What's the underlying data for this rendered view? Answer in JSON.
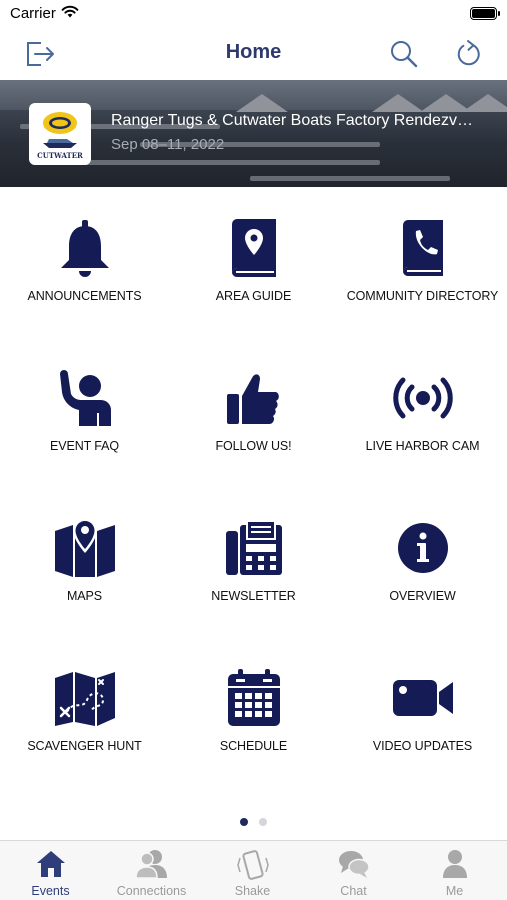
{
  "status_bar": {
    "carrier": "Carrier"
  },
  "nav": {
    "title": "Home"
  },
  "banner": {
    "title": "Ranger Tugs & Cutwater Boats Factory Rendezv…",
    "date": "Sep 08–11, 2022",
    "logo_text": "CUTWATER"
  },
  "tiles": [
    {
      "label": "ANNOUNCEMENTS",
      "icon": "bell-icon"
    },
    {
      "label": "AREA GUIDE",
      "icon": "map-book-icon"
    },
    {
      "label": "COMMUNITY DIRECTORY",
      "icon": "phone-book-icon"
    },
    {
      "label": "EVENT FAQ",
      "icon": "raised-hand-person-icon"
    },
    {
      "label": "FOLLOW US!",
      "icon": "thumbs-up-icon"
    },
    {
      "label": "LIVE HARBOR CAM",
      "icon": "broadcast-icon"
    },
    {
      "label": "MAPS",
      "icon": "map-pin-icon"
    },
    {
      "label": "NEWSLETTER",
      "icon": "fax-icon"
    },
    {
      "label": "OVERVIEW",
      "icon": "info-icon"
    },
    {
      "label": "SCAVENGER HUNT",
      "icon": "treasure-map-icon"
    },
    {
      "label": "SCHEDULE",
      "icon": "calendar-icon"
    },
    {
      "label": "VIDEO UPDATES",
      "icon": "video-camera-icon"
    }
  ],
  "pager": {
    "pages": 2,
    "current": 1
  },
  "tabs": [
    {
      "label": "Events",
      "icon": "home-icon",
      "active": true
    },
    {
      "label": "Connections",
      "icon": "people-icon",
      "active": false
    },
    {
      "label": "Shake",
      "icon": "shake-phone-icon",
      "active": false
    },
    {
      "label": "Chat",
      "icon": "chat-bubbles-icon",
      "active": false
    },
    {
      "label": "Me",
      "icon": "person-icon",
      "active": false
    }
  ],
  "colors": {
    "icon": "#141b55",
    "nav_icon": "#4a6a9c",
    "tab_inactive": "#9a9a9a",
    "tab_active": "#2f3d7a"
  }
}
